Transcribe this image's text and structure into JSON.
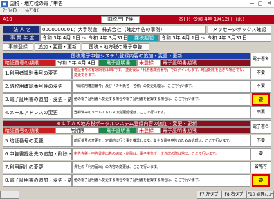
{
  "titlebar": {
    "title": "国税・地方税の電子申告",
    "min": "—",
    "max": "▢",
    "close": "✕"
  },
  "menu": [
    "ﾌｧｲﾙ(F)",
    "ﾍﾙﾌﾟ(H)"
  ],
  "header": {
    "code": "A10",
    "tab": "国税庁HP等",
    "date": "本日：令和 4年 1月12日（水）"
  },
  "corp": {
    "label": "法 人 名",
    "value": "0000000001：大手製造　株式会社（確定申告の事例）",
    "msg_button": "メッセージボックス確認"
  },
  "period": {
    "label": "事 業 年 度",
    "value": "令和 3年 4月 1日 ～ 令和 4年 3月31日",
    "tag": "課税期間",
    "value2": "令和 3年 4月 1日 ～ 令和 4年 3月31日"
  },
  "tabs": [
    "事前登録",
    "追加・変更・更新",
    "国税・地方税の電子申告"
  ],
  "etax": {
    "section_title": "国税電子申告システム登録内容の追加・変更・更新",
    "sign_header": "電子署名",
    "expiry_label": "暗証番号の期限",
    "expiry_value": "令和 5年 4月 4日",
    "cert_label": "電子証明書",
    "cert_status": "未登録",
    "cert_expiry_label": "電子証明書期限",
    "rows": [
      {
        "name": "1.利用者識別番号の変更",
        "desc": "暗証番号の有効期限は3年です。\n変更後は「利用者識別番号」でログインします。暗証期限を過ぎた場合でも、変更できます。",
        "sign": "不要",
        "red": true,
        "highlight": false
      },
      {
        "name": "2.納税用確認番号等の変更",
        "desc": "「納税用確認番号」及び「カナ氏名・名称」の変更処理は、ここで行います。",
        "sign": "不要",
        "red": false,
        "highlight": false
      },
      {
        "name": "3.電子証明書の追加・変更・更新",
        "desc": "他の電子証明書へ変更する場合や電子証明書を登録する場合は、ここで行います。",
        "sign": "要",
        "red": false,
        "highlight": true
      },
      {
        "name": "4.メールアドレスの変更",
        "desc": "登録済みのメールアドレスの変更処理は、ここで行います。",
        "sign": "不要",
        "red": false,
        "highlight": false
      }
    ]
  },
  "eltax": {
    "section_title": "ｅＬＴＡＸ地方税ポータルシステム登録内容の追加・変更・更新",
    "sign_header": "電子署名",
    "expiry_label": "暗証番号の期限",
    "expiry_value": "無期限",
    "cert_label": "電子証明書",
    "cert_status": "未登録",
    "cert_expiry_label": "電子証明書期限",
    "rows": [
      {
        "name": "5.暗証番号の変更",
        "desc": "暗証番号の変更を、定期的に行う事を推奨します。安全な電子申告のための処理は、ここで行います。",
        "sign": "不要",
        "red": false,
        "highlight": false
      },
      {
        "name": "6.申告書提出先の追加・削除・確認",
        "desc": "申告先税・申告書提出先の追加・削除は、電子申告データ作成の際は常に、ここで行います。",
        "sign": "要",
        "red": true,
        "highlight": false
      },
      {
        "name": "7.利用届出の変更",
        "desc": "貴社の「利用届出」の内容の変更は、ここで行います。",
        "sign": "省略可",
        "red": false,
        "highlight": false
      },
      {
        "name": "8.電子証明書の追加・変更・更新",
        "desc": "他の電子証明書へ変更する場合や電子証明書を登録する場合は、ここで行います。",
        "sign": "要",
        "red": false,
        "highlight": true
      }
    ]
  },
  "footer": {
    "f7": "F7 左タブ",
    "f8": "F8 右タブ",
    "f10": "F10 処理ﾒﾆｭｰ"
  }
}
